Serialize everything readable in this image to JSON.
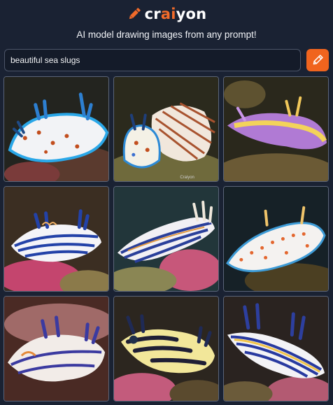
{
  "brand": {
    "name_left": "cr",
    "name_accent": "ai",
    "name_right": "yon",
    "accent_color": "#f26b2a"
  },
  "tagline": "AI model drawing images from any prompt!",
  "search": {
    "value": "beautiful sea slugs",
    "button_icon": "pencil-icon"
  },
  "results": {
    "count_shown": 9,
    "watermark": "Craiyon",
    "items": [
      {
        "subject": "white sea slug with blue edges and orange spots"
      },
      {
        "subject": "white and orange striped sea slug with blue spots"
      },
      {
        "subject": "purple sea slug with yellow stripes"
      },
      {
        "subject": "blue and white striped sea slug"
      },
      {
        "subject": "blue, white and orange striped sea slug"
      },
      {
        "subject": "white sea slug with orange spots and blue trim"
      },
      {
        "subject": "white and blue sea slug with orange accents"
      },
      {
        "subject": "yellow and white sea slug with dark bands"
      },
      {
        "subject": "blue and yellow striped sea slug"
      }
    ]
  }
}
